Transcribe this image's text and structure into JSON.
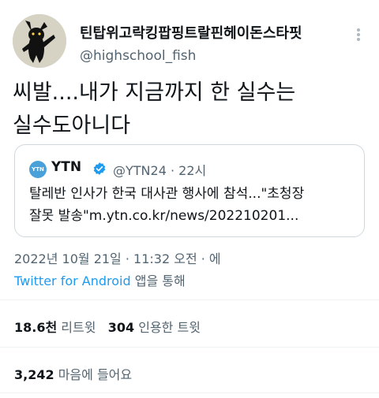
{
  "author": {
    "display_name": "틴탑위고락킹팝핑트랄핀헤이돈스타핏",
    "handle": "@highschool_fish"
  },
  "tweet_text_line1": "씨발....내가 지금까지 한 실수는",
  "tweet_text_line2": "실수도아니다",
  "quoted": {
    "logo_text": "YTN",
    "name": "YTN",
    "handle_time": "@YTN24 · 22시",
    "text_line1": "탈레반 인사가 한국 대사관 행사에 참석...\"초청장",
    "text_line2": "잘못 발송\"m.ytn.co.kr/news/202210201..."
  },
  "timestamp": "2022년 10월 21일 · 11:32 오전 · 에",
  "source_link": "Twitter for Android",
  "source_suffix": " 앱을 통해",
  "stats": {
    "retweets_count": "18.6천",
    "retweets_label": "리트윗",
    "quotes_count": "304",
    "quotes_label": "인용한 트윗",
    "likes_count": "3,242",
    "likes_label": "마음에 들어요"
  },
  "colors": {
    "link": "#1d9bf0",
    "secondary_text": "#536471",
    "border": "#cfd9de",
    "verified": "#1d9bf0"
  },
  "icons": {
    "avatar": "black-cat-avatar",
    "more": "more-vertical-icon",
    "verified": "verified-badge-icon"
  }
}
